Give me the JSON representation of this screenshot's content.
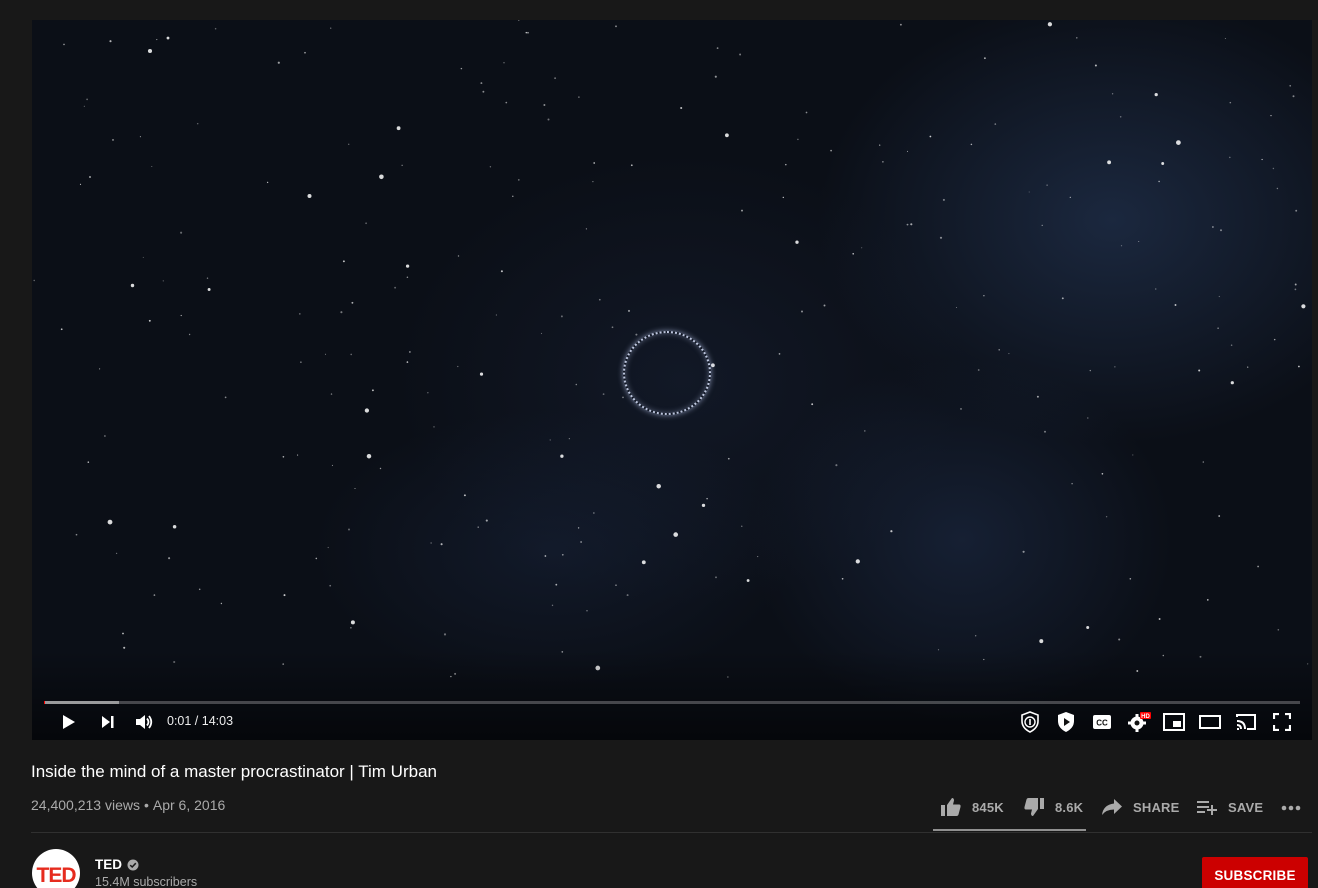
{
  "player": {
    "time_display": "0:01 / 14:03",
    "progress_played_fraction": 0.001,
    "progress_loaded_fraction": 0.06,
    "controls": [
      "play-icon",
      "next-icon",
      "volume-icon",
      "extension-1-icon",
      "extension-2-icon",
      "captions-icon",
      "settings-hd-icon",
      "miniplayer-icon",
      "theater-icon",
      "cast-icon",
      "fullscreen-icon"
    ],
    "hd_badge": "HD"
  },
  "video": {
    "title": "Inside the mind of a master procrastinator | Tim Urban",
    "views": "24,400,213 views",
    "separator": "•",
    "date": "Apr 6, 2016"
  },
  "actions": {
    "like_count": "845K",
    "dislike_count": "8.6K",
    "share_label": "SHARE",
    "save_label": "SAVE"
  },
  "channel": {
    "avatar_text": "TED",
    "name": "TED",
    "subscribers": "15.4M subscribers",
    "subscribe_label": "SUBSCRIBE"
  },
  "colors": {
    "background": "#181818",
    "subscribe": "#cc0000",
    "progress": "#ff0000",
    "ted_red": "#e62b1e"
  }
}
